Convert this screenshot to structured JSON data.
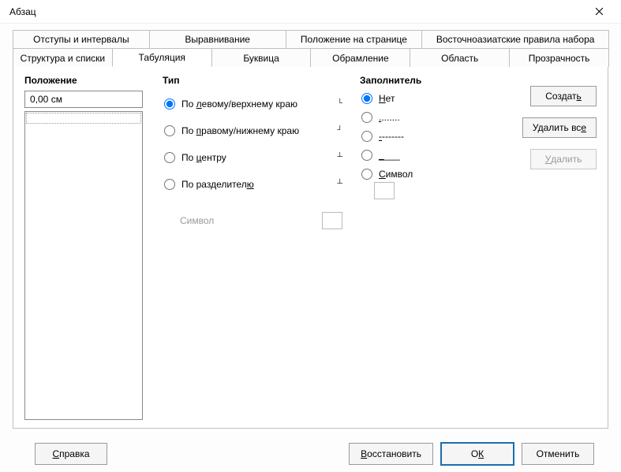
{
  "window": {
    "title": "Абзац"
  },
  "tabs": {
    "row1": [
      "Отступы и интервалы",
      "Выравнивание",
      "Положение на странице",
      "Восточноазиатские правила набора"
    ],
    "row2": [
      "Структура и списки",
      "Табуляция",
      "Буквица",
      "Обрамление",
      "Область",
      "Прозрачность"
    ],
    "active": "Табуляция"
  },
  "position": {
    "header": "Положение",
    "value": "0,00 см"
  },
  "type": {
    "header": "Тип",
    "options": [
      {
        "pre": "По ",
        "u": "л",
        "post": "евому/верхнему краю",
        "glyph": "└",
        "checked": true
      },
      {
        "pre": "По ",
        "u": "п",
        "post": "равому/нижнему краю",
        "glyph": "┘",
        "checked": false
      },
      {
        "pre": "По ",
        "u": "ц",
        "post": "ентру",
        "glyph": "┴",
        "checked": false
      },
      {
        "pre": "По разделител",
        "u": "ю",
        "post": "",
        "glyph": "┴",
        "checked": false
      }
    ],
    "symbol_label": "Символ"
  },
  "fill": {
    "header": "Заполнитель",
    "options": [
      {
        "pre": "",
        "u": "Н",
        "post": "ет",
        "checked": true
      },
      {
        "pre": "",
        "u": ".",
        "post": ".......",
        "checked": false
      },
      {
        "pre": "",
        "u": "-",
        "post": "-------",
        "checked": false
      },
      {
        "pre": "",
        "u": "_",
        "post": "___",
        "checked": false
      },
      {
        "pre": "",
        "u": "С",
        "post": "имвол",
        "checked": false
      }
    ]
  },
  "side_buttons": {
    "create": {
      "pre": "Создат",
      "u": "ь",
      "post": ""
    },
    "delete_all": {
      "pre": "Удалить вс",
      "u": "е",
      "post": ""
    },
    "delete": {
      "pre": "",
      "u": "У",
      "post": "далить"
    }
  },
  "footer": {
    "help": {
      "pre": "",
      "u": "С",
      "post": "правка"
    },
    "restore": {
      "pre": "",
      "u": "В",
      "post": "осстановить"
    },
    "ok": {
      "pre": "О",
      "u": "К",
      "post": ""
    },
    "cancel": {
      "pre": "Отменить"
    }
  }
}
